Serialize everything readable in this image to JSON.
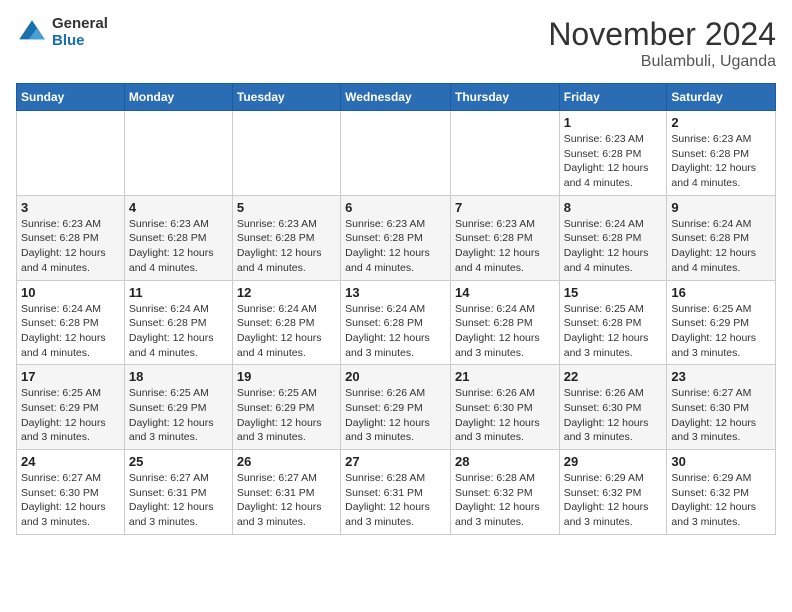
{
  "logo": {
    "general": "General",
    "blue": "Blue"
  },
  "header": {
    "month": "November 2024",
    "location": "Bulambuli, Uganda"
  },
  "weekdays": [
    "Sunday",
    "Monday",
    "Tuesday",
    "Wednesday",
    "Thursday",
    "Friday",
    "Saturday"
  ],
  "weeks": [
    [
      {
        "day": "",
        "info": ""
      },
      {
        "day": "",
        "info": ""
      },
      {
        "day": "",
        "info": ""
      },
      {
        "day": "",
        "info": ""
      },
      {
        "day": "",
        "info": ""
      },
      {
        "day": "1",
        "info": "Sunrise: 6:23 AM\nSunset: 6:28 PM\nDaylight: 12 hours and 4 minutes."
      },
      {
        "day": "2",
        "info": "Sunrise: 6:23 AM\nSunset: 6:28 PM\nDaylight: 12 hours and 4 minutes."
      }
    ],
    [
      {
        "day": "3",
        "info": "Sunrise: 6:23 AM\nSunset: 6:28 PM\nDaylight: 12 hours and 4 minutes."
      },
      {
        "day": "4",
        "info": "Sunrise: 6:23 AM\nSunset: 6:28 PM\nDaylight: 12 hours and 4 minutes."
      },
      {
        "day": "5",
        "info": "Sunrise: 6:23 AM\nSunset: 6:28 PM\nDaylight: 12 hours and 4 minutes."
      },
      {
        "day": "6",
        "info": "Sunrise: 6:23 AM\nSunset: 6:28 PM\nDaylight: 12 hours and 4 minutes."
      },
      {
        "day": "7",
        "info": "Sunrise: 6:23 AM\nSunset: 6:28 PM\nDaylight: 12 hours and 4 minutes."
      },
      {
        "day": "8",
        "info": "Sunrise: 6:24 AM\nSunset: 6:28 PM\nDaylight: 12 hours and 4 minutes."
      },
      {
        "day": "9",
        "info": "Sunrise: 6:24 AM\nSunset: 6:28 PM\nDaylight: 12 hours and 4 minutes."
      }
    ],
    [
      {
        "day": "10",
        "info": "Sunrise: 6:24 AM\nSunset: 6:28 PM\nDaylight: 12 hours and 4 minutes."
      },
      {
        "day": "11",
        "info": "Sunrise: 6:24 AM\nSunset: 6:28 PM\nDaylight: 12 hours and 4 minutes."
      },
      {
        "day": "12",
        "info": "Sunrise: 6:24 AM\nSunset: 6:28 PM\nDaylight: 12 hours and 4 minutes."
      },
      {
        "day": "13",
        "info": "Sunrise: 6:24 AM\nSunset: 6:28 PM\nDaylight: 12 hours and 3 minutes."
      },
      {
        "day": "14",
        "info": "Sunrise: 6:24 AM\nSunset: 6:28 PM\nDaylight: 12 hours and 3 minutes."
      },
      {
        "day": "15",
        "info": "Sunrise: 6:25 AM\nSunset: 6:28 PM\nDaylight: 12 hours and 3 minutes."
      },
      {
        "day": "16",
        "info": "Sunrise: 6:25 AM\nSunset: 6:29 PM\nDaylight: 12 hours and 3 minutes."
      }
    ],
    [
      {
        "day": "17",
        "info": "Sunrise: 6:25 AM\nSunset: 6:29 PM\nDaylight: 12 hours and 3 minutes."
      },
      {
        "day": "18",
        "info": "Sunrise: 6:25 AM\nSunset: 6:29 PM\nDaylight: 12 hours and 3 minutes."
      },
      {
        "day": "19",
        "info": "Sunrise: 6:25 AM\nSunset: 6:29 PM\nDaylight: 12 hours and 3 minutes."
      },
      {
        "day": "20",
        "info": "Sunrise: 6:26 AM\nSunset: 6:29 PM\nDaylight: 12 hours and 3 minutes."
      },
      {
        "day": "21",
        "info": "Sunrise: 6:26 AM\nSunset: 6:30 PM\nDaylight: 12 hours and 3 minutes."
      },
      {
        "day": "22",
        "info": "Sunrise: 6:26 AM\nSunset: 6:30 PM\nDaylight: 12 hours and 3 minutes."
      },
      {
        "day": "23",
        "info": "Sunrise: 6:27 AM\nSunset: 6:30 PM\nDaylight: 12 hours and 3 minutes."
      }
    ],
    [
      {
        "day": "24",
        "info": "Sunrise: 6:27 AM\nSunset: 6:30 PM\nDaylight: 12 hours and 3 minutes."
      },
      {
        "day": "25",
        "info": "Sunrise: 6:27 AM\nSunset: 6:31 PM\nDaylight: 12 hours and 3 minutes."
      },
      {
        "day": "26",
        "info": "Sunrise: 6:27 AM\nSunset: 6:31 PM\nDaylight: 12 hours and 3 minutes."
      },
      {
        "day": "27",
        "info": "Sunrise: 6:28 AM\nSunset: 6:31 PM\nDaylight: 12 hours and 3 minutes."
      },
      {
        "day": "28",
        "info": "Sunrise: 6:28 AM\nSunset: 6:32 PM\nDaylight: 12 hours and 3 minutes."
      },
      {
        "day": "29",
        "info": "Sunrise: 6:29 AM\nSunset: 6:32 PM\nDaylight: 12 hours and 3 minutes."
      },
      {
        "day": "30",
        "info": "Sunrise: 6:29 AM\nSunset: 6:32 PM\nDaylight: 12 hours and 3 minutes."
      }
    ]
  ]
}
